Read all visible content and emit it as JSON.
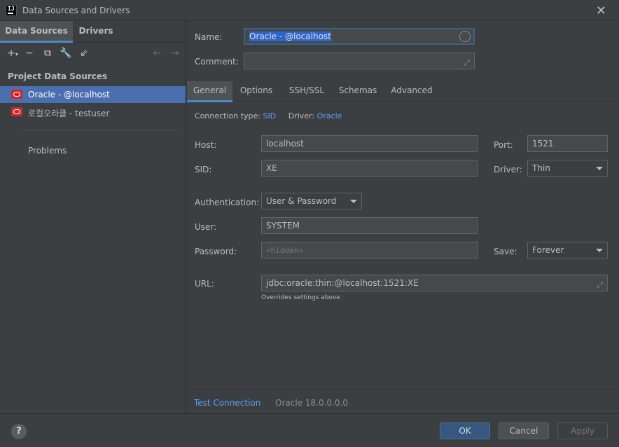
{
  "window": {
    "title": "Data Sources and Drivers",
    "logo_text": "IJ"
  },
  "left": {
    "tabs": [
      {
        "label": "Data Sources"
      },
      {
        "label": "Drivers"
      }
    ],
    "section_title": "Project Data Sources",
    "items": [
      {
        "label": "Oracle - @localhost",
        "icon": "oracle-icon"
      },
      {
        "label": "로컬오라클 - testuser",
        "icon": "oracle-icon"
      }
    ],
    "problems": "Problems"
  },
  "form": {
    "name_label": "Name:",
    "name_value": "Oracle - @localhost",
    "comment_label": "Comment:",
    "comment_value": "",
    "tabs": [
      {
        "label": "General"
      },
      {
        "label": "Options"
      },
      {
        "label": "SSH/SSL"
      },
      {
        "label": "Schemas"
      },
      {
        "label": "Advanced"
      }
    ],
    "conn_type_label": "Connection type:",
    "conn_type_value": "SID",
    "driver_label": "Driver:",
    "driver_value": "Oracle",
    "host_label": "Host:",
    "host_value": "localhost",
    "port_label": "Port:",
    "port_value": "1521",
    "sid_label": "SID:",
    "sid_value": "XE",
    "driver2_label": "Driver:",
    "driver2_value": "Thin",
    "auth_label": "Authentication:",
    "auth_value": "User & Password",
    "user_label": "User:",
    "user_value": "SYSTEM",
    "password_label": "Password:",
    "password_placeholder": "<hidden>",
    "save_label": "Save:",
    "save_value": "Forever",
    "url_label": "URL:",
    "url_value": "jdbc:oracle:thin:@localhost:1521:XE",
    "url_note": "Overrides settings above",
    "test_connection": "Test Connection",
    "server_version": "Oracle 18.0.0.0.0"
  },
  "footer": {
    "help": "?",
    "ok": "OK",
    "cancel": "Cancel",
    "apply": "Apply"
  },
  "colors": {
    "accent": "#4a88c7",
    "selection": "#4b6eaf",
    "link": "#589df6",
    "oracle": "#cc2a2a"
  }
}
